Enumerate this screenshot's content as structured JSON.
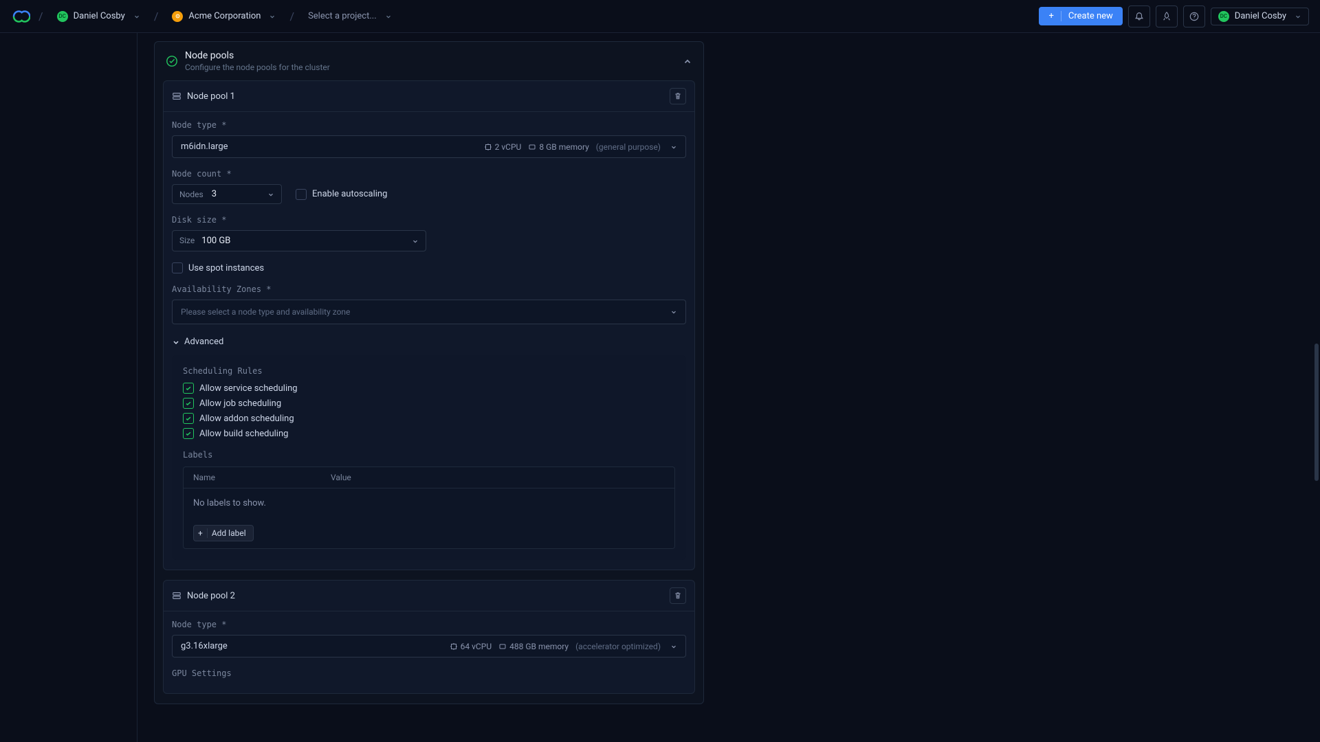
{
  "header": {
    "user_name": "Daniel Cosby",
    "user_initials": "DC",
    "org_name": "Acme Corporation",
    "project_placeholder": "Select a project...",
    "create_new": "Create new"
  },
  "section": {
    "title": "Node pools",
    "subtitle": "Configure the node pools for the cluster"
  },
  "labels": {
    "node_type": "Node type *",
    "node_count": "Node count *",
    "disk_size": "Disk size *",
    "availability_zones": "Availability Zones *",
    "advanced": "Advanced",
    "scheduling_rules": "Scheduling Rules",
    "labels_heading": "Labels",
    "labels_name_col": "Name",
    "labels_value_col": "Value",
    "labels_empty": "No labels to show.",
    "add_label": "Add label",
    "enable_autoscaling": "Enable autoscaling",
    "use_spot": "Use spot instances",
    "az_placeholder": "Please select a node type and availability zone",
    "nodes_prefix": "Nodes",
    "size_prefix": "Size",
    "gpu_settings": "GPU Settings"
  },
  "pools": [
    {
      "title": "Node pool 1",
      "node_type": "m6idn.large",
      "vcpu": "2 vCPU",
      "memory": "8 GB memory",
      "purpose": "(general purpose)",
      "node_count": "3",
      "disk_size": "100 GB",
      "rules": [
        "Allow service scheduling",
        "Allow job scheduling",
        "Allow addon scheduling",
        "Allow build scheduling"
      ]
    },
    {
      "title": "Node pool 2",
      "node_type": "g3.16xlarge",
      "vcpu": "64 vCPU",
      "memory": "488 GB memory",
      "purpose": "(accelerator optimized)"
    }
  ]
}
